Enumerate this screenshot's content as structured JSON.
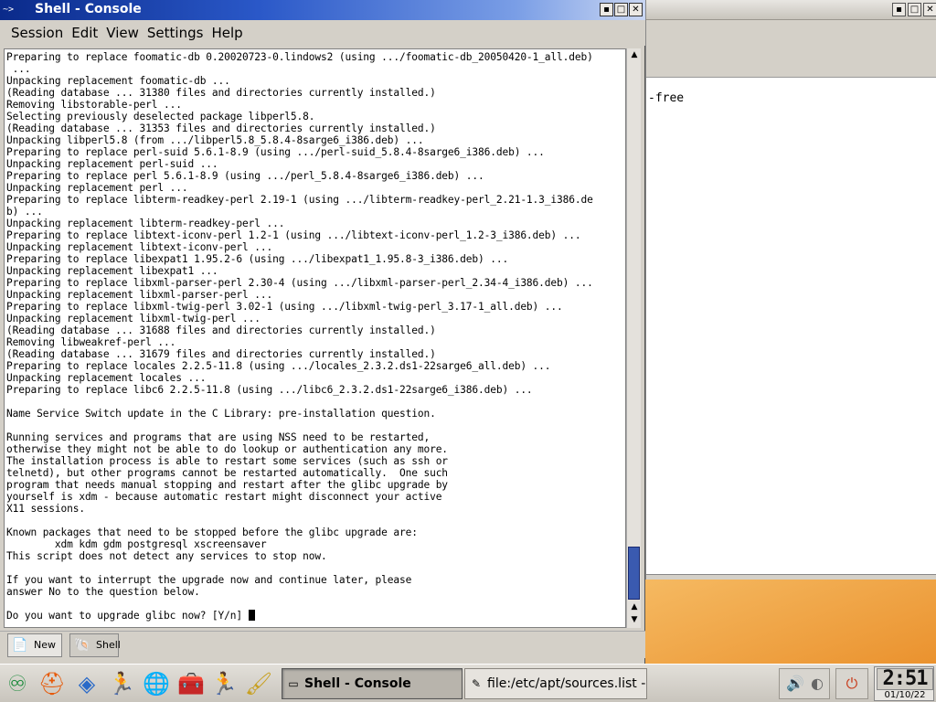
{
  "background_window": {
    "editor_visible_text": "-free",
    "title_buttons": [
      "▪",
      "□",
      "✕"
    ]
  },
  "konsole": {
    "title": "Shell - Console",
    "title_icon_text": "~>",
    "title_buttons": [
      "▪",
      "□",
      "✕"
    ],
    "menu": [
      "Session",
      "Edit",
      "View",
      "Settings",
      "Help"
    ],
    "terminal_lines": [
      "Preparing to replace foomatic-db 0.20020723-0.lindows2 (using .../foomatic-db_20050420-1_all.deb)",
      " ...",
      "Unpacking replacement foomatic-db ...",
      "(Reading database ... 31380 files and directories currently installed.)",
      "Removing libstorable-perl ...",
      "Selecting previously deselected package libperl5.8.",
      "(Reading database ... 31353 files and directories currently installed.)",
      "Unpacking libperl5.8 (from .../libperl5.8_5.8.4-8sarge6_i386.deb) ...",
      "Preparing to replace perl-suid 5.6.1-8.9 (using .../perl-suid_5.8.4-8sarge6_i386.deb) ...",
      "Unpacking replacement perl-suid ...",
      "Preparing to replace perl 5.6.1-8.9 (using .../perl_5.8.4-8sarge6_i386.deb) ...",
      "Unpacking replacement perl ...",
      "Preparing to replace libterm-readkey-perl 2.19-1 (using .../libterm-readkey-perl_2.21-1.3_i386.de",
      "b) ...",
      "Unpacking replacement libterm-readkey-perl ...",
      "Preparing to replace libtext-iconv-perl 1.2-1 (using .../libtext-iconv-perl_1.2-3_i386.deb) ...",
      "Unpacking replacement libtext-iconv-perl ...",
      "Preparing to replace libexpat1 1.95.2-6 (using .../libexpat1_1.95.8-3_i386.deb) ...",
      "Unpacking replacement libexpat1 ...",
      "Preparing to replace libxml-parser-perl 2.30-4 (using .../libxml-parser-perl_2.34-4_i386.deb) ...",
      "Unpacking replacement libxml-parser-perl ...",
      "Preparing to replace libxml-twig-perl 3.02-1 (using .../libxml-twig-perl_3.17-1_all.deb) ...",
      "Unpacking replacement libxml-twig-perl ...",
      "(Reading database ... 31688 files and directories currently installed.)",
      "Removing libweakref-perl ...",
      "(Reading database ... 31679 files and directories currently installed.)",
      "Preparing to replace locales 2.2.5-11.8 (using .../locales_2.3.2.ds1-22sarge6_all.deb) ...",
      "Unpacking replacement locales ...",
      "Preparing to replace libc6 2.2.5-11.8 (using .../libc6_2.3.2.ds1-22sarge6_i386.deb) ...",
      "",
      "Name Service Switch update in the C Library: pre-installation question.",
      "",
      "Running services and programs that are using NSS need to be restarted,",
      "otherwise they might not be able to do lookup or authentication any more.",
      "The installation process is able to restart some services (such as ssh or",
      "telnetd), but other programs cannot be restarted automatically.  One such",
      "program that needs manual stopping and restart after the glibc upgrade by",
      "yourself is xdm - because automatic restart might disconnect your active",
      "X11 sessions.",
      "",
      "Known packages that need to be stopped before the glibc upgrade are:",
      "        xdm kdm gdm postgresql xscreensaver",
      "This script does not detect any services to stop now.",
      "",
      "If you want to interrupt the upgrade now and continue later, please",
      "answer No to the question below.",
      "",
      "Do you want to upgrade glibc now? [Y/n] "
    ],
    "session_tabs": [
      {
        "label": "New",
        "icon": "new-session-icon"
      },
      {
        "label": "Shell",
        "icon": "shell-icon"
      }
    ]
  },
  "taskbar": {
    "launchers": [
      "kde-menu-icon",
      "lifebuoy-help-icon",
      "package-cube-icon",
      "runner-icon",
      "globe-browser-icon",
      "toolbox-icon",
      "network-figure-icon",
      "brush-icon"
    ],
    "tasks": [
      {
        "label": "Shell - Console",
        "active": true,
        "icon": "terminal-icon"
      },
      {
        "label": "file:/etc/apt/sources.list - T",
        "active": false,
        "icon": "document-icon"
      }
    ],
    "clock": {
      "time": "2:51",
      "date": "01/10/22"
    }
  }
}
